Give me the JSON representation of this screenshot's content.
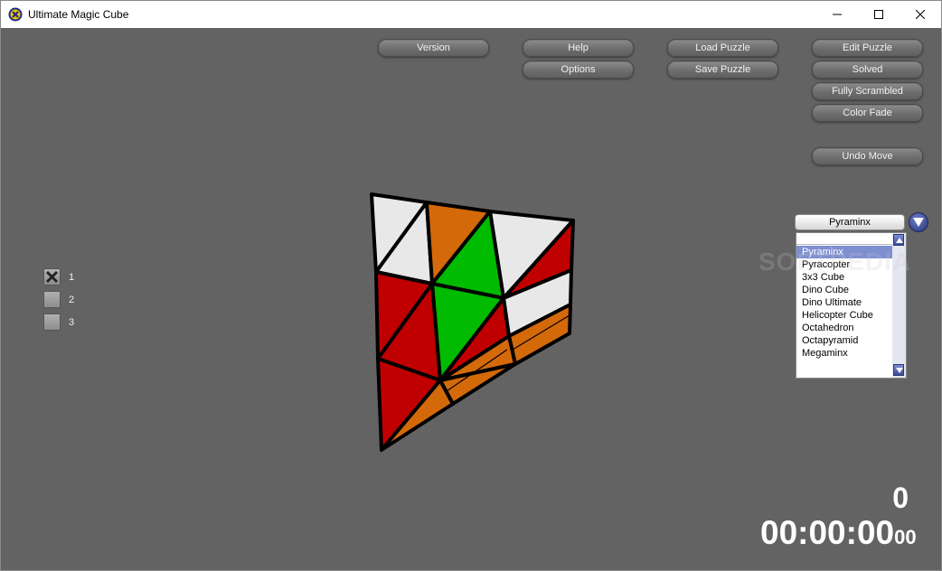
{
  "window": {
    "title": "Ultimate Magic Cube"
  },
  "toolbar": {
    "version": "Version",
    "help": "Help",
    "options": "Options",
    "load_puzzle": "Load Puzzle",
    "save_puzzle": "Save Puzzle",
    "edit_puzzle": "Edit Puzzle",
    "solved": "Solved",
    "fully_scrambled": "Fully Scrambled",
    "color_fade": "Color Fade",
    "undo_move": "Undo Move"
  },
  "layers": [
    {
      "label": "1",
      "checked": true
    },
    {
      "label": "2",
      "checked": false
    },
    {
      "label": "3",
      "checked": false
    }
  ],
  "puzzle_select": {
    "selected": "Pyraminx",
    "search_value": "",
    "options": [
      "Pyraminx",
      "Pyracopter",
      "3x3 Cube",
      "Dino Cube",
      "Dino Ultimate",
      "Helicopter Cube",
      "Octahedron",
      "Octapyramid",
      "Megaminx"
    ]
  },
  "watermark": "SOFTPEDIA",
  "stats": {
    "move_count": "0",
    "time": "00:00:00",
    "time_fraction": "00"
  },
  "colors": {
    "background": "#636363",
    "white": "#e8e8e8",
    "orange": "#d4690a",
    "green": "#00bb00",
    "red": "#c00000",
    "accent": "#7e8fd0"
  }
}
